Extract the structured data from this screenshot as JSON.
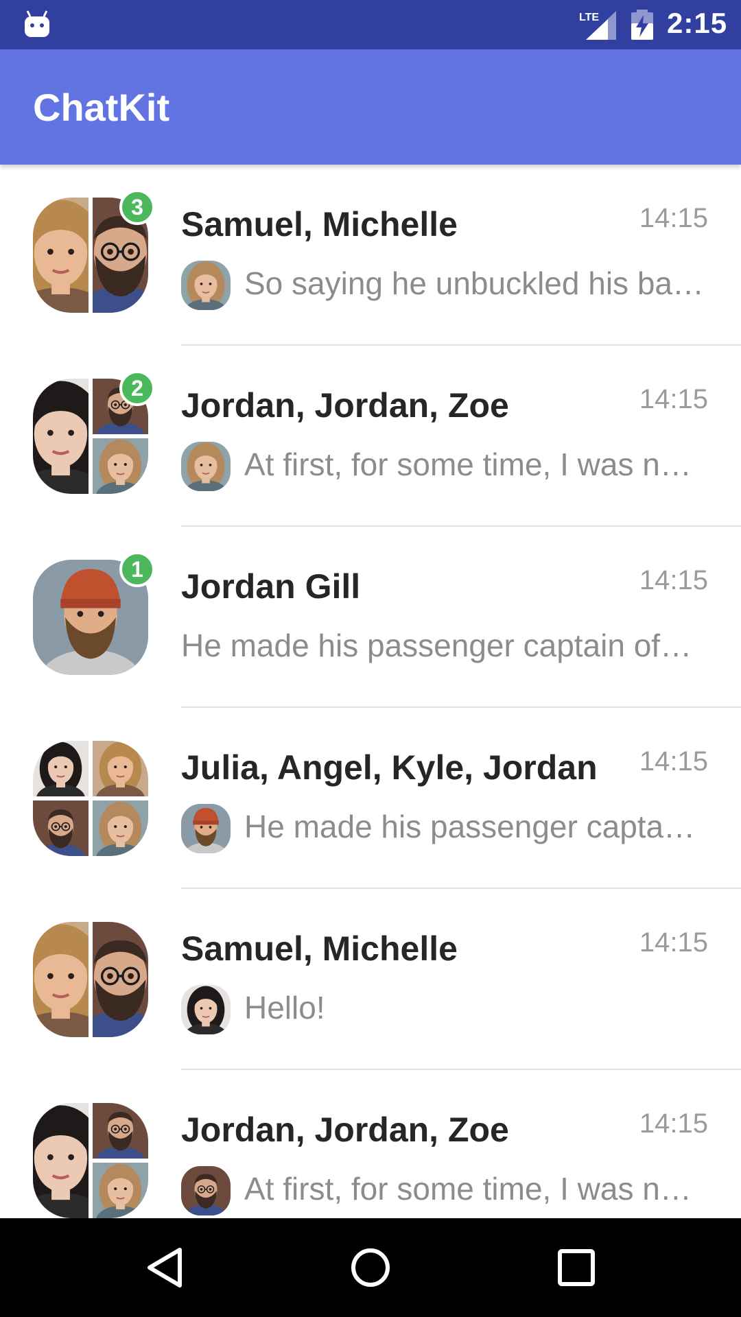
{
  "status_bar": {
    "time": "2:15",
    "network_label": "LTE",
    "icons": [
      "android-notification-icon",
      "lte-signal-icon",
      "battery-charging-icon"
    ]
  },
  "app_bar": {
    "title": "ChatKit"
  },
  "dialogs": [
    {
      "name": "Samuel, Michelle",
      "time": "14:15",
      "unread": "3",
      "message": "So saying he unbuckled his ba…",
      "avatar_people": [
        "woman-blonde",
        "man-beard-glasses"
      ],
      "author": "woman-blonde-2"
    },
    {
      "name": "Jordan, Jordan, Zoe",
      "time": "14:15",
      "unread": "2",
      "message": "At first, for some time, I was n…",
      "avatar_people": [
        "woman-dark-hair",
        "man-beard-glasses",
        "woman-blonde-2"
      ],
      "author": "woman-blonde-2"
    },
    {
      "name": "Jordan Gill",
      "time": "14:15",
      "unread": "1",
      "message": "He made his passenger captain of…",
      "avatar_people": [
        "man-beanie"
      ],
      "author": ""
    },
    {
      "name": "Julia, Angel, Kyle, Jordan",
      "time": "14:15",
      "unread": "",
      "message": "He made his passenger capta…",
      "avatar_people": [
        "woman-dark-hair",
        "woman-blonde",
        "man-beard-glasses",
        "woman-blonde-2"
      ],
      "author": "man-beanie"
    },
    {
      "name": "Samuel, Michelle",
      "time": "14:15",
      "unread": "",
      "message": "Hello!",
      "avatar_people": [
        "woman-blonde",
        "man-beard-glasses"
      ],
      "author": "woman-dark-hair"
    },
    {
      "name": "Jordan, Jordan, Zoe",
      "time": "14:15",
      "unread": "",
      "message": "At first, for some time, I was n…",
      "avatar_people": [
        "woman-dark-hair",
        "man-beard-glasses",
        "woman-blonde-2"
      ],
      "author": "man-beard-glasses"
    }
  ],
  "nav_bar": {
    "buttons": [
      "back-icon",
      "home-icon",
      "recents-icon"
    ]
  },
  "colors": {
    "status_bar": "#3140a0",
    "app_bar": "#6174e2",
    "badge": "#4cb85c",
    "name_text": "#262626",
    "message_text": "#8c8c8c",
    "time_text": "#9a9a9a"
  }
}
